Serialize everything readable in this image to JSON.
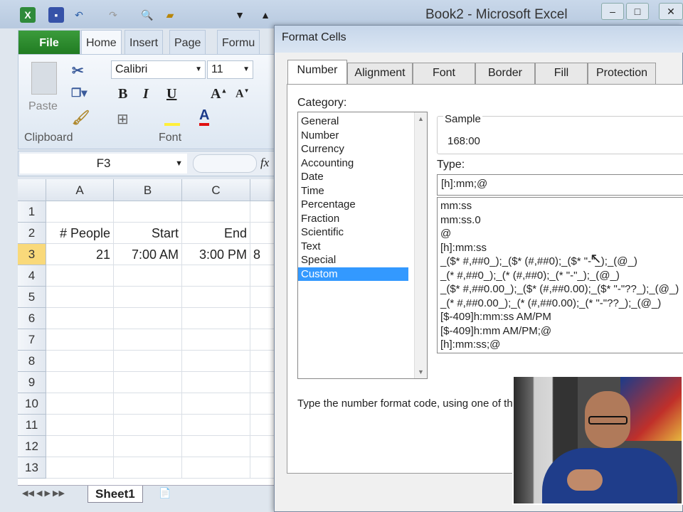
{
  "app": {
    "title": "Book2 - Microsoft Excel"
  },
  "ribbon": {
    "tabs": [
      "File",
      "Home",
      "Insert",
      "Page L",
      "Formu"
    ],
    "font_name": "Calibri",
    "font_size": "11",
    "paste_label": "Paste",
    "clipboard_label": "Clipboard",
    "font_label": "Font",
    "bold": "B",
    "italic": "I",
    "underline": "U"
  },
  "formula_bar": {
    "name_box": "F3",
    "fx": "fx"
  },
  "sheet": {
    "columns": [
      "A",
      "B",
      "C"
    ],
    "rows": [
      "1",
      "2",
      "3",
      "4",
      "5",
      "6",
      "7",
      "8",
      "9",
      "10",
      "11",
      "12",
      "13"
    ],
    "cells": {
      "A2": "# People",
      "B2": "Start",
      "C2": "End",
      "A3": "21",
      "B3": "7:00 AM",
      "C3": "3:00 PM",
      "D3": "8"
    },
    "tab": "Sheet1"
  },
  "dialog": {
    "title": "Format Cells",
    "tabs": [
      "Number",
      "Alignment",
      "Font",
      "Border",
      "Fill",
      "Protection"
    ],
    "category_label": "Category:",
    "categories": [
      "General",
      "Number",
      "Currency",
      "Accounting",
      "Date",
      "Time",
      "Percentage",
      "Fraction",
      "Scientific",
      "Text",
      "Special",
      "Custom"
    ],
    "selected_category": "Custom",
    "sample_label": "Sample",
    "sample_value": "168:00",
    "type_label": "Type:",
    "type_value": "[h]:mm;@",
    "type_list": [
      "mm:ss",
      "mm:ss.0",
      "@",
      "[h]:mm:ss",
      "_($* #,##0_);_($* (#,##0);_($* \"-\"_);_(@_)",
      "_(* #,##0_);_(* (#,##0);_(* \"-\"_);_(@_)",
      "_($* #,##0.00_);_($* (#,##0.00);_($* \"-\"??_);_(@_)",
      "_(* #,##0.00_);_(* (#,##0.00);_(* \"-\"??_);_(@_)",
      "[$-409]h:mm:ss AM/PM",
      "[$-409]h:mm AM/PM;@",
      "[h]:mm:ss;@"
    ],
    "description": "Type the number format code, using one of the existing codes as a starting point."
  }
}
